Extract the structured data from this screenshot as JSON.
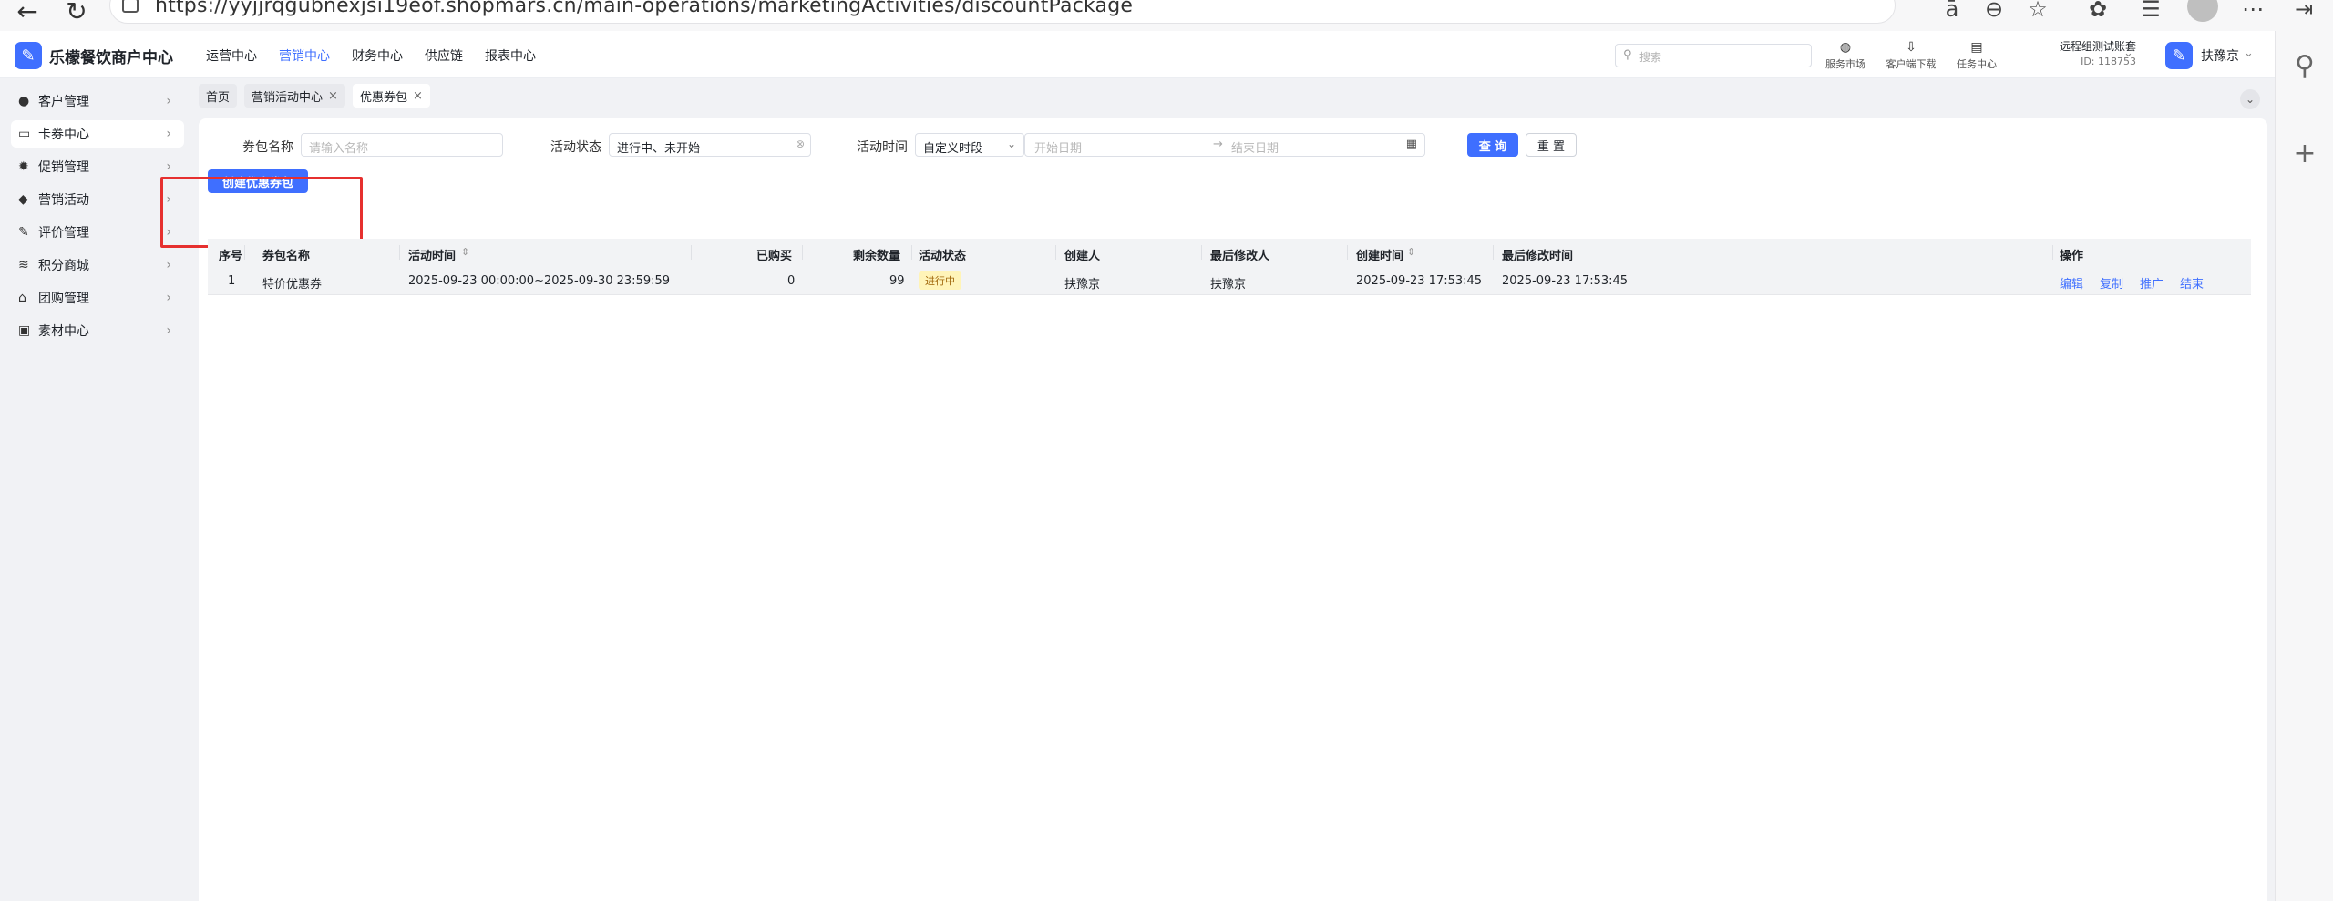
{
  "browser": {
    "url": "https://yyjjrqgubnexjsi19eof.shopmars.cn/main-operations/marketingActivities/discountPackage"
  },
  "header": {
    "brand": "乐檬餐饮商户中心",
    "menu": [
      "运营中心",
      "营销中心",
      "财务中心",
      "供应链",
      "报表中心"
    ],
    "active_menu": "营销中心",
    "search_placeholder": "搜索",
    "tools": [
      "服务市场",
      "客户端下载",
      "任务中心"
    ],
    "account_name": "远程组测试账套",
    "account_id": "ID: 118753",
    "user_name": "扶豫京"
  },
  "sidebar": {
    "items": [
      {
        "label": "客户管理",
        "icon": "user-icon"
      },
      {
        "label": "卡券中心",
        "icon": "card-icon",
        "active": true
      },
      {
        "label": "促销管理",
        "icon": "gear-icon"
      },
      {
        "label": "营销活动",
        "icon": "tag-icon"
      },
      {
        "label": "评价管理",
        "icon": "edit-icon"
      },
      {
        "label": "积分商城",
        "icon": "coins-icon"
      },
      {
        "label": "团购管理",
        "icon": "store-icon"
      },
      {
        "label": "素材中心",
        "icon": "image-icon"
      }
    ]
  },
  "tabs": [
    {
      "label": "首页",
      "closable": false
    },
    {
      "label": "营销活动中心",
      "closable": true
    },
    {
      "label": "优惠券包",
      "closable": true,
      "active": true
    }
  ],
  "filters": {
    "name_label": "券包名称",
    "name_placeholder": "请输入名称",
    "status_label": "活动状态",
    "status_value": "进行中、未开始",
    "time_label": "活动时间",
    "time_type": "自定义时段",
    "start_placeholder": "开始日期",
    "end_placeholder": "结束日期",
    "query_button": "查 询",
    "reset_button": "重 置"
  },
  "create_button": "创建优惠券包",
  "table": {
    "columns": [
      "序号",
      "券包名称",
      "活动时间",
      "已购买",
      "剩余数量",
      "活动状态",
      "创建人",
      "最后修改人",
      "创建时间",
      "最后修改时间",
      "操作"
    ],
    "rows": [
      {
        "index": "1",
        "name": "特价优惠券",
        "time": "2025-09-23 00:00:00~2025-09-30 23:59:59",
        "bought": "0",
        "remaining": "99",
        "status": "进行中",
        "creator": "扶豫京",
        "modifier": "扶豫京",
        "created": "2025-09-23 17:53:45",
        "modified": "2025-09-23 17:53:45",
        "actions": [
          "编辑",
          "复制",
          "推广",
          "结束"
        ]
      }
    ]
  },
  "colors": {
    "accent": "#3f6fff",
    "highlight_box": "#e6302f",
    "status_badge_bg": "#fff4b8"
  }
}
